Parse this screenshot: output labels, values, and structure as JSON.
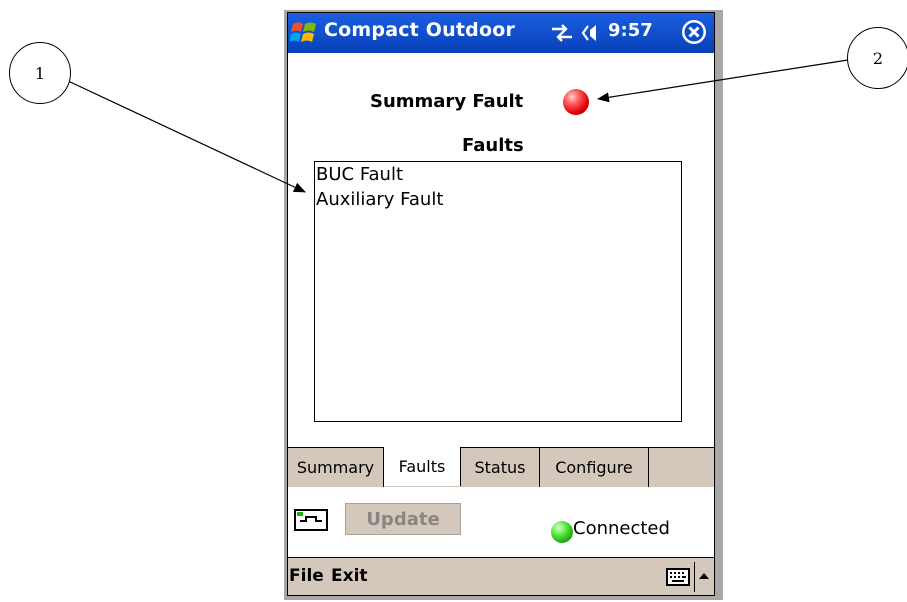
{
  "titlebar": {
    "app_title": "Compact Outdoor",
    "clock": "9:57"
  },
  "summary": {
    "label": "Summary Fault",
    "led_color": "#e00000"
  },
  "faults": {
    "label": "Faults",
    "items": [
      "BUC Fault",
      "Auxiliary Fault"
    ]
  },
  "tabs": [
    {
      "label": "Summary",
      "active": false
    },
    {
      "label": "Faults",
      "active": true
    },
    {
      "label": "Status",
      "active": false
    },
    {
      "label": "Configure",
      "active": false
    }
  ],
  "toolbar": {
    "update_label": "Update",
    "connection_label": "Connected",
    "connection_led_color": "#1fae10"
  },
  "menubar": {
    "file_label": "File",
    "exit_label": "Exit"
  },
  "callouts": {
    "one": "1",
    "two": "2"
  },
  "colors": {
    "titlebar": "#0a4ecb",
    "tab_bg": "#d4c8bd"
  }
}
